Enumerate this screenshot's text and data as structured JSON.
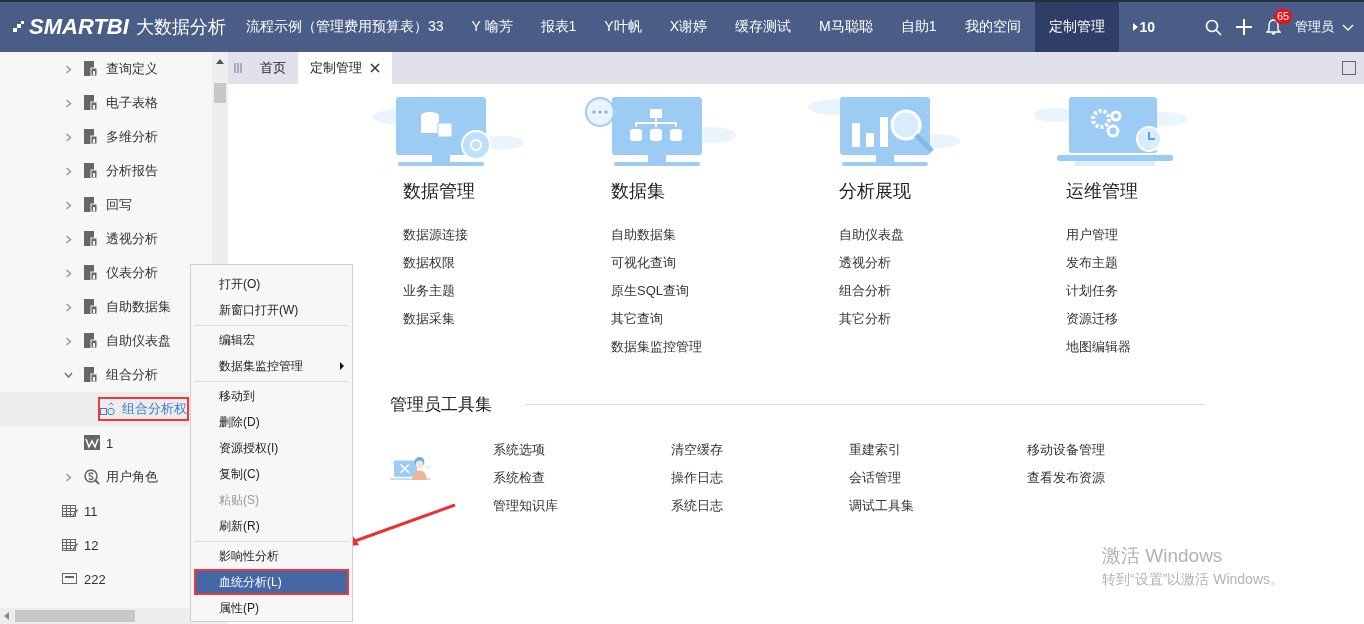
{
  "header": {
    "logo": "SMARTBI",
    "product": "大数据分析",
    "nav": [
      {
        "label": "流程示例（管理费用预算表）33",
        "selected": false
      },
      {
        "label": "Y 喻芳",
        "selected": false
      },
      {
        "label": "报表1",
        "selected": false
      },
      {
        "label": "Y叶帆",
        "selected": false
      },
      {
        "label": "X谢婷",
        "selected": false
      },
      {
        "label": "缓存测试",
        "selected": false
      },
      {
        "label": "M马聪聪",
        "selected": false
      },
      {
        "label": "自助1",
        "selected": false
      },
      {
        "label": "我的空间",
        "selected": false
      },
      {
        "label": "定制管理",
        "selected": true
      }
    ],
    "overflow_count": "10",
    "notification_count": "65",
    "user": "管理员"
  },
  "sidebar": {
    "tree": [
      {
        "label": "查询定义",
        "kind": "folder",
        "expanded": false,
        "selected": false,
        "annotated": false
      },
      {
        "label": "电子表格",
        "kind": "folder",
        "expanded": false,
        "selected": false,
        "annotated": false
      },
      {
        "label": "多维分析",
        "kind": "folder",
        "expanded": false,
        "selected": false,
        "annotated": false
      },
      {
        "label": "分析报告",
        "kind": "folder",
        "expanded": false,
        "selected": false,
        "annotated": false
      },
      {
        "label": "回写",
        "kind": "folder",
        "expanded": false,
        "selected": false,
        "annotated": false
      },
      {
        "label": "透视分析",
        "kind": "folder",
        "expanded": false,
        "selected": false,
        "annotated": false
      },
      {
        "label": "仪表分析",
        "kind": "folder",
        "expanded": false,
        "selected": false,
        "annotated": false
      },
      {
        "label": "自助数据集",
        "kind": "folder",
        "expanded": false,
        "selected": false,
        "annotated": false
      },
      {
        "label": "自助仪表盘",
        "kind": "folder",
        "expanded": false,
        "selected": false,
        "annotated": false
      },
      {
        "label": "组合分析",
        "kind": "folder",
        "expanded": true,
        "selected": false,
        "annotated": false,
        "children": [
          {
            "label": "组合分析权",
            "kind": "combo",
            "selected": true,
            "annotated": true
          }
        ]
      },
      {
        "label": "1",
        "kind": "word",
        "selected": false,
        "annotated": false
      },
      {
        "label": "用户角色",
        "kind": "role",
        "expanded": false,
        "selected": false,
        "annotated": false
      },
      {
        "label": "11",
        "kind": "sheet",
        "selected": false,
        "annotated": false
      },
      {
        "label": "12",
        "kind": "sheet",
        "selected": false,
        "annotated": false
      },
      {
        "label": "222",
        "kind": "form",
        "selected": false,
        "annotated": false
      }
    ]
  },
  "context_menu": {
    "groups": [
      {
        "items": [
          {
            "label": "打开(O)",
            "disabled": false,
            "selected": false,
            "submenu": false,
            "annotated": false
          },
          {
            "label": "新窗口打开(W)",
            "disabled": false,
            "selected": false,
            "submenu": false,
            "annotated": false
          }
        ]
      },
      {
        "items": [
          {
            "label": "编辑宏",
            "disabled": false,
            "selected": false,
            "submenu": false,
            "annotated": false
          },
          {
            "label": "数据集监控管理",
            "disabled": false,
            "selected": false,
            "submenu": true,
            "annotated": false
          }
        ]
      },
      {
        "items": [
          {
            "label": "移动到",
            "disabled": false,
            "selected": false,
            "submenu": false,
            "annotated": false
          },
          {
            "label": "删除(D)",
            "disabled": false,
            "selected": false,
            "submenu": false,
            "annotated": false
          },
          {
            "label": "资源授权(I)",
            "disabled": false,
            "selected": false,
            "submenu": false,
            "annotated": false
          },
          {
            "label": "复制(C)",
            "disabled": false,
            "selected": false,
            "submenu": false,
            "annotated": false
          },
          {
            "label": "粘贴(S)",
            "disabled": true,
            "selected": false,
            "submenu": false,
            "annotated": false
          },
          {
            "label": "刷新(R)",
            "disabled": false,
            "selected": false,
            "submenu": false,
            "annotated": false
          }
        ]
      },
      {
        "items": [
          {
            "label": "影响性分析",
            "disabled": false,
            "selected": false,
            "submenu": false,
            "annotated": false
          },
          {
            "label": "血统分析(L)",
            "disabled": false,
            "selected": true,
            "submenu": false,
            "annotated": true
          },
          {
            "label": "属性(P)",
            "disabled": false,
            "selected": false,
            "submenu": false,
            "annotated": false
          }
        ]
      }
    ]
  },
  "tabs": [
    {
      "label": "首页",
      "selected": false,
      "closable": false
    },
    {
      "label": "定制管理",
      "selected": true,
      "closable": true
    }
  ],
  "modules": [
    {
      "title": "数据管理",
      "links": [
        "数据源连接",
        "数据权限",
        "业务主题",
        "数据采集"
      ]
    },
    {
      "title": "数据集",
      "links": [
        "自助数据集",
        "可视化查询",
        "原生SQL查询",
        "其它查询",
        "数据集监控管理"
      ]
    },
    {
      "title": "分析展现",
      "links": [
        "自助仪表盘",
        "透视分析",
        "组合分析",
        "其它分析"
      ]
    },
    {
      "title": "运维管理",
      "links": [
        "用户管理",
        "发布主题",
        "计划任务",
        "资源迁移",
        "地图编辑器"
      ]
    }
  ],
  "admin_tools": {
    "title": "管理员工具集",
    "tools": [
      "系统选项",
      "清空缓存",
      "重建索引",
      "移动设备管理",
      "系统检查",
      "操作日志",
      "会话管理",
      "查看发布资源",
      "管理知识库",
      "系统日志",
      "调试工具集"
    ]
  },
  "os_notice": {
    "title": "激活 Windows",
    "subtitle": "转到“设置”以激活 Windows。"
  }
}
